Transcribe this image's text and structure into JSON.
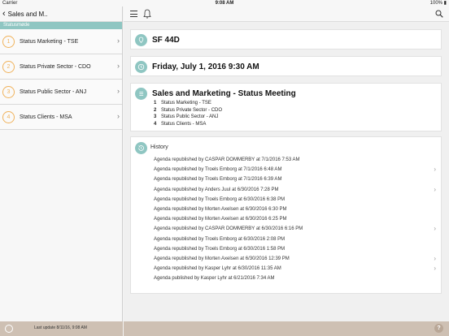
{
  "statusbar": {
    "carrier": "Carrier ",
    "time": "9:08 AM",
    "battery": "100% ▮"
  },
  "sidebar": {
    "back_label": "Sales and M..",
    "section_label": "Statusmøde",
    "items": [
      {
        "number": "1",
        "label": "Status Marketing - TSE"
      },
      {
        "number": "2",
        "label": "Status Private Sector - CDO"
      },
      {
        "number": "3",
        "label": "Status Public Sector - ANJ"
      },
      {
        "number": "4",
        "label": "Status Clients - MSA"
      }
    ],
    "footer_text": "Last update 8/11/16, 9:08 AM"
  },
  "main": {
    "room": "SF 44D",
    "datetime": "Friday, July 1, 2016 9:30 AM",
    "meeting_title": "Sales and Marketing - Status Meeting",
    "agenda": [
      {
        "number": "1",
        "label": "Status Marketing - TSE"
      },
      {
        "number": "2",
        "label": "Status Private Sector - CDO"
      },
      {
        "number": "3",
        "label": "Status Public Sector - ANJ"
      },
      {
        "number": "4",
        "label": "Status Clients - MSA"
      }
    ],
    "history_label": "History",
    "history": [
      "Agenda republished by CASPAR DOMMERBY at 7/1/2016 7:53 AM",
      "Agenda republished by Troels Emborg at 7/1/2016 6:48 AM",
      "Agenda republished by Troels Emborg at 7/1/2016 6:39 AM",
      "Agenda republished by Anders Juul at 6/30/2016 7:28 PM",
      "Agenda republished by Troels Emborg at 6/30/2016 6:38 PM",
      "Agenda republished by Morten Axelsen at 6/30/2016 6:30 PM",
      "Agenda republished by Morten Axelsen at 6/30/2016 6:25 PM",
      "Agenda republished by CASPAR DOMMERBY at 6/30/2016 6:16 PM",
      "Agenda republished by Troels Emborg at 6/30/2016 2:08 PM",
      "Agenda republished by Troels Emborg at 6/30/2016 1:58 PM",
      "Agenda republished by Morten Axelsen at 6/30/2016 12:39 PM",
      "Agenda republished by Kasper Lyhr at 6/30/2016 11:35 AM",
      "Agenda published by Kasper Lyhr at 6/21/2016 7:34 AM"
    ],
    "help_label": "?"
  },
  "colors": {
    "accent": "#8fc6c2",
    "number_circle": "#f0b25a",
    "footer": "#cec0b3"
  }
}
